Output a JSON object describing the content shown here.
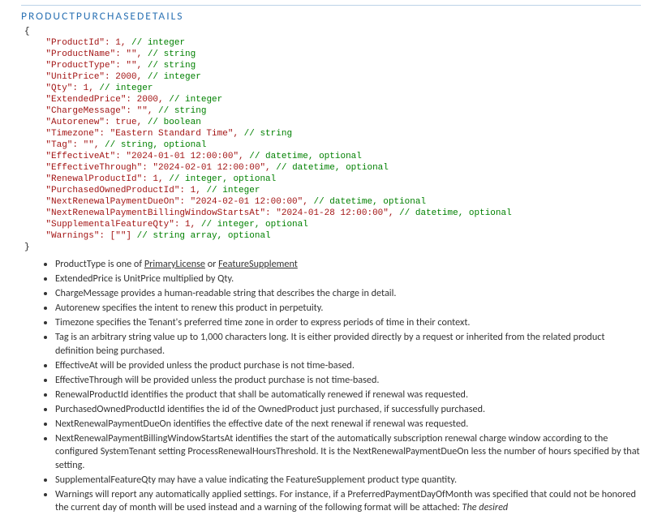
{
  "heading": "PRODUCTPURCHASEDETAILS",
  "code": {
    "open": "{",
    "close": "}",
    "lines": [
      {
        "t": "    \"ProductId\": 1, ",
        "c": "// integer"
      },
      {
        "t": "    \"ProductName\": \"\", ",
        "c": "// string"
      },
      {
        "t": "    \"ProductType\": \"\", ",
        "c": "// string"
      },
      {
        "t": "    \"UnitPrice\": 2000, ",
        "c": "// integer"
      },
      {
        "t": "    \"Qty\": 1, ",
        "c": "// integer"
      },
      {
        "t": "    \"ExtendedPrice\": 2000, ",
        "c": "// integer"
      },
      {
        "t": "    \"ChargeMessage\": \"\", ",
        "c": "// string"
      },
      {
        "t": "    \"Autorenew\": true, ",
        "c": "// boolean"
      },
      {
        "t": "    \"Timezone\": \"Eastern Standard Time\", ",
        "c": "// string"
      },
      {
        "t": "    \"Tag\": \"\", ",
        "c": "// string, optional"
      },
      {
        "t": "    \"EffectiveAt\": \"2024-01-01 12:00:00\", ",
        "c": "// datetime, optional"
      },
      {
        "t": "    \"EffectiveThrough\": \"2024-02-01 12:00:00\", ",
        "c": "// datetime, optional"
      },
      {
        "t": "    \"RenewalProductId\": 1, ",
        "c": "// integer, optional"
      },
      {
        "t": "    \"PurchasedOwnedProductId\": 1, ",
        "c": "// integer"
      },
      {
        "t": "    \"NextRenewalPaymentDueOn\": \"2024-02-01 12:00:00\", ",
        "c": "// datetime, optional"
      },
      {
        "t": "    \"NextRenewalPaymentBillingWindowStartsAt\": \"2024-01-28 12:00:00\", ",
        "c": "// datetime, optional"
      },
      {
        "t": "    \"SupplementalFeatureQty\": 1, ",
        "c": "// integer, optional"
      },
      {
        "t": "    \"Warnings\": [\"\"] ",
        "c": "// string array, optional"
      }
    ]
  },
  "links": {
    "primary": "PrimaryLicense",
    "feature": "FeatureSupplement"
  },
  "bullets": {
    "b0a": "ProductType is one of ",
    "b0b": " or ",
    "b1": "ExtendedPrice is UnitPrice multiplied by Qty.",
    "b2": "ChargeMessage provides a human-readable string that describes the charge in detail.",
    "b3": "Autorenew specifies the intent to renew this product in perpetuity.",
    "b4": "Timezone specifies the Tenant's preferred time zone in order to express periods of time in their context.",
    "b5": "Tag is an arbitrary string value up to 1,000 characters long. It is either provided directly by a request or inherited from the related product definition being purchased.",
    "b6": "EffectiveAt will be provided unless the product purchase is not time-based.",
    "b7": "EffectiveThrough will be provided unless the product purchase is not time-based.",
    "b8": "RenewalProductId identifies the product that shall be automatically renewed if renewal was requested.",
    "b9": "PurchasedOwnedProductId identifies the id of the OwnedProduct just purchased, if successfully purchased.",
    "b10": "NextRenewalPaymentDueOn identifies the effective date of the next renewal if renewal was requested.",
    "b11": "NextRenewalPaymentBillingWindowStartsAt identifies the start of the automatically subscription renewal charge window according to the configured SystemTenant setting ProcessRenewalHoursThreshold.  It is the NextRenewalPaymentDueOn less the number of hours specified by that setting.",
    "b12": "SupplementalFeatureQty may have a value indicating the FeatureSupplement product type quantity.",
    "b13a": "Warnings will report any automatically applied settings.  For instance, if a PreferredPaymentDayOfMonth was specified that could not be honored the current day of month will be used instead and a warning of the following format will be attached: ",
    "b13b": "The desired"
  }
}
